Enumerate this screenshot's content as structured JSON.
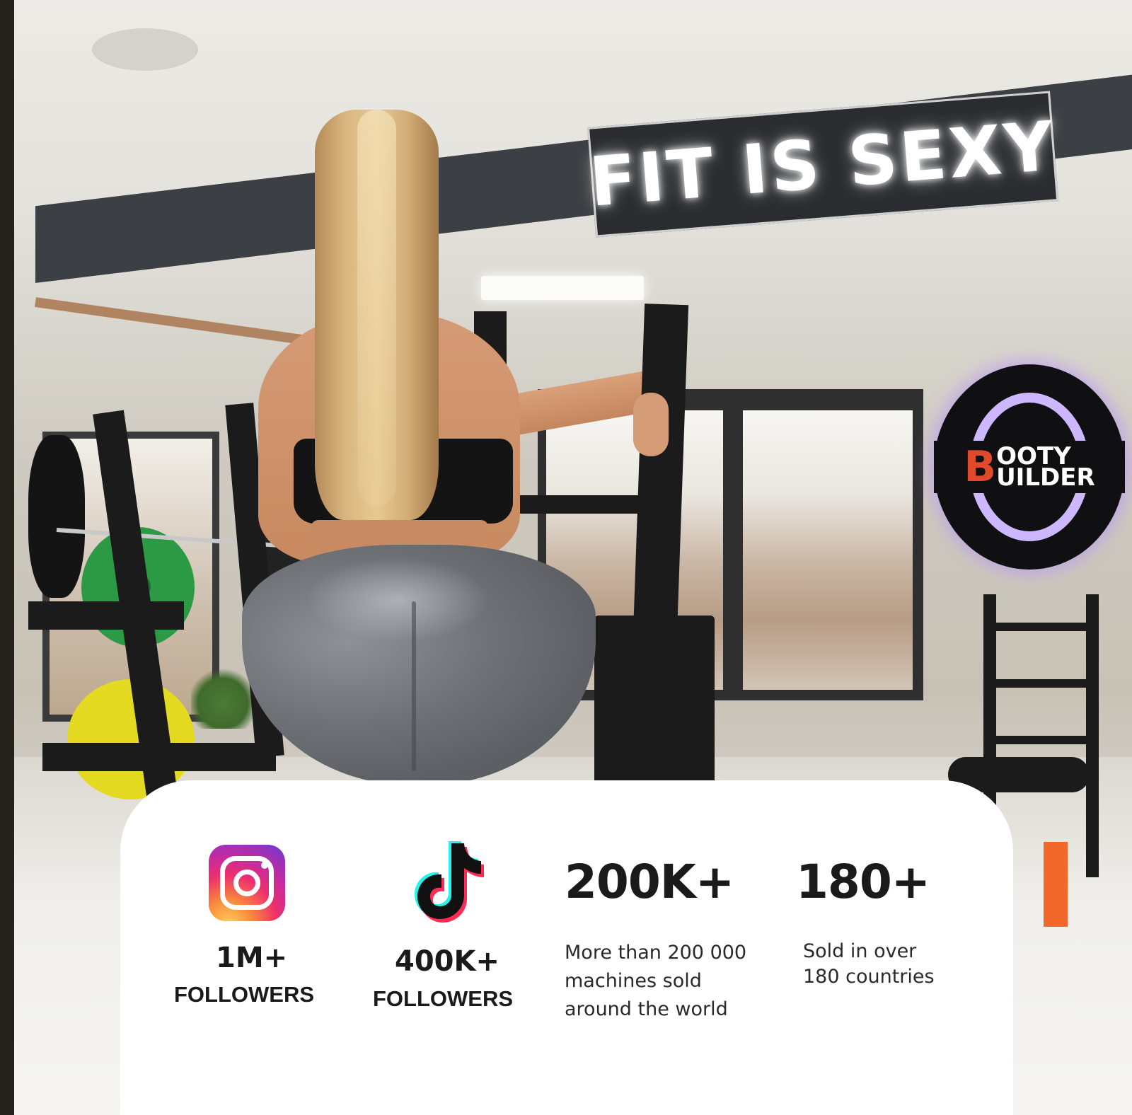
{
  "hero": {
    "sign_text": "FIT IS SEXY",
    "logo_text_1": "B",
    "logo_text_2": "OOTY",
    "logo_text_3": "UILDER"
  },
  "stats": [
    {
      "icon": "instagram-icon",
      "value": "1M+",
      "caption": "FOLLOWERS"
    },
    {
      "icon": "tiktok-icon",
      "value": "400K+",
      "caption": "FOLLOWERS"
    },
    {
      "value": "200K+",
      "description": [
        "More than 200 000",
        "machines sold",
        "around the world"
      ]
    },
    {
      "value": "180+",
      "description": [
        "Sold in over",
        "180 countries"
      ]
    }
  ],
  "colors": {
    "card_background": "#ffffff",
    "text": "#1a1a1a",
    "logo_accent": "#e0492c",
    "logo_glow": "#cdb8ff",
    "instagram_gradient": [
      "#fdd05a",
      "#fb8a3b",
      "#ee2f6d",
      "#c22ba0",
      "#6a3ad6"
    ],
    "tiktok_cyan": "#25f4ee",
    "tiktok_red": "#fe2c55"
  }
}
